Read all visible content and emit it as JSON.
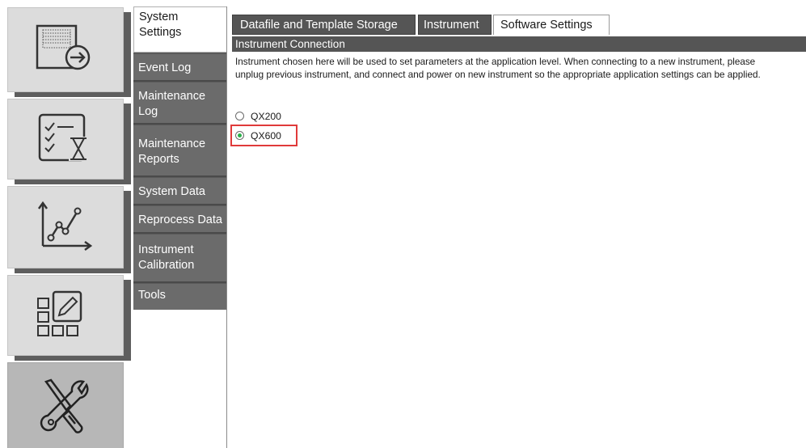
{
  "rail": {
    "items": [
      {
        "icon": "data-export-icon"
      },
      {
        "icon": "checklist-hourglass-icon"
      },
      {
        "icon": "line-chart-icon"
      },
      {
        "icon": "plate-layout-edit-icon"
      },
      {
        "icon": "tools-icon"
      }
    ]
  },
  "subnav": {
    "items": [
      {
        "line1": "System",
        "line2": "Settings"
      },
      {
        "line1": "Event Log",
        "line2": ""
      },
      {
        "line1": "Maintenance",
        "line2": "Log"
      },
      {
        "line1": "Maintenance",
        "line2": "Reports"
      },
      {
        "line1": "System Data",
        "line2": ""
      },
      {
        "line1": "Reprocess Data",
        "line2": ""
      },
      {
        "line1": "Instrument",
        "line2": "Calibration"
      },
      {
        "line1": "Tools",
        "line2": ""
      }
    ]
  },
  "tabs": [
    {
      "label": "Datafile and Template Storage"
    },
    {
      "label": "Instrument"
    },
    {
      "label": "Software Settings"
    }
  ],
  "section": {
    "title": "Instrument Connection",
    "description": "Instrument chosen here will be used to set parameters at the application level. When connecting to a new instrument, please unplug previous instrument, and connect and power on new instrument so the appropriate application settings can be applied."
  },
  "options": [
    {
      "label": "QX200",
      "checked": false
    },
    {
      "label": "QX600",
      "checked": true
    }
  ],
  "colors": {
    "highlight": "#e03a3a",
    "radio_selected": "#2bb04a",
    "header_bg": "#555555"
  }
}
